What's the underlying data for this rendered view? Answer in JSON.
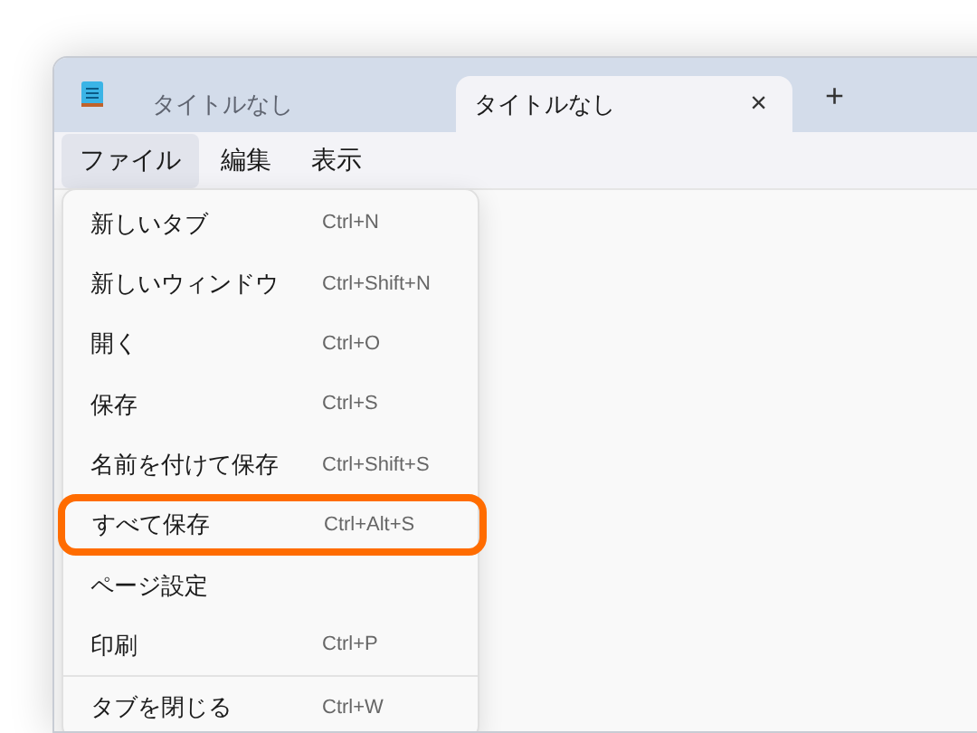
{
  "tabs": [
    {
      "title": "タイトルなし",
      "selected": false
    },
    {
      "title": "タイトルなし",
      "selected": true,
      "close": "×"
    }
  ],
  "new_tab": "+",
  "menu_bar": [
    {
      "label": "ファイル",
      "selected": true
    },
    {
      "label": "編集",
      "selected": false
    },
    {
      "label": "表示",
      "selected": false
    }
  ],
  "file_menu": [
    {
      "kind": "item",
      "label": "新しいタブ",
      "shortcut": "Ctrl+N",
      "highlighted": false
    },
    {
      "kind": "item",
      "label": "新しいウィンドウ",
      "shortcut": "Ctrl+Shift+N",
      "highlighted": false
    },
    {
      "kind": "item",
      "label": "開く",
      "shortcut": "Ctrl+O",
      "highlighted": false
    },
    {
      "kind": "item",
      "label": "保存",
      "shortcut": "Ctrl+S",
      "highlighted": false
    },
    {
      "kind": "item",
      "label": "名前を付けて保存",
      "shortcut": "Ctrl+Shift+S",
      "highlighted": false
    },
    {
      "kind": "item",
      "label": "すべて保存",
      "shortcut": "Ctrl+Alt+S",
      "highlighted": true
    },
    {
      "kind": "item",
      "label": "ページ設定",
      "highlighted": false
    },
    {
      "kind": "item",
      "label": "印刷",
      "shortcut": "Ctrl+P",
      "highlighted": false
    },
    {
      "kind": "separator"
    },
    {
      "kind": "item",
      "label": "タブを閉じる",
      "shortcut": "Ctrl+W",
      "highlighted": false
    }
  ]
}
